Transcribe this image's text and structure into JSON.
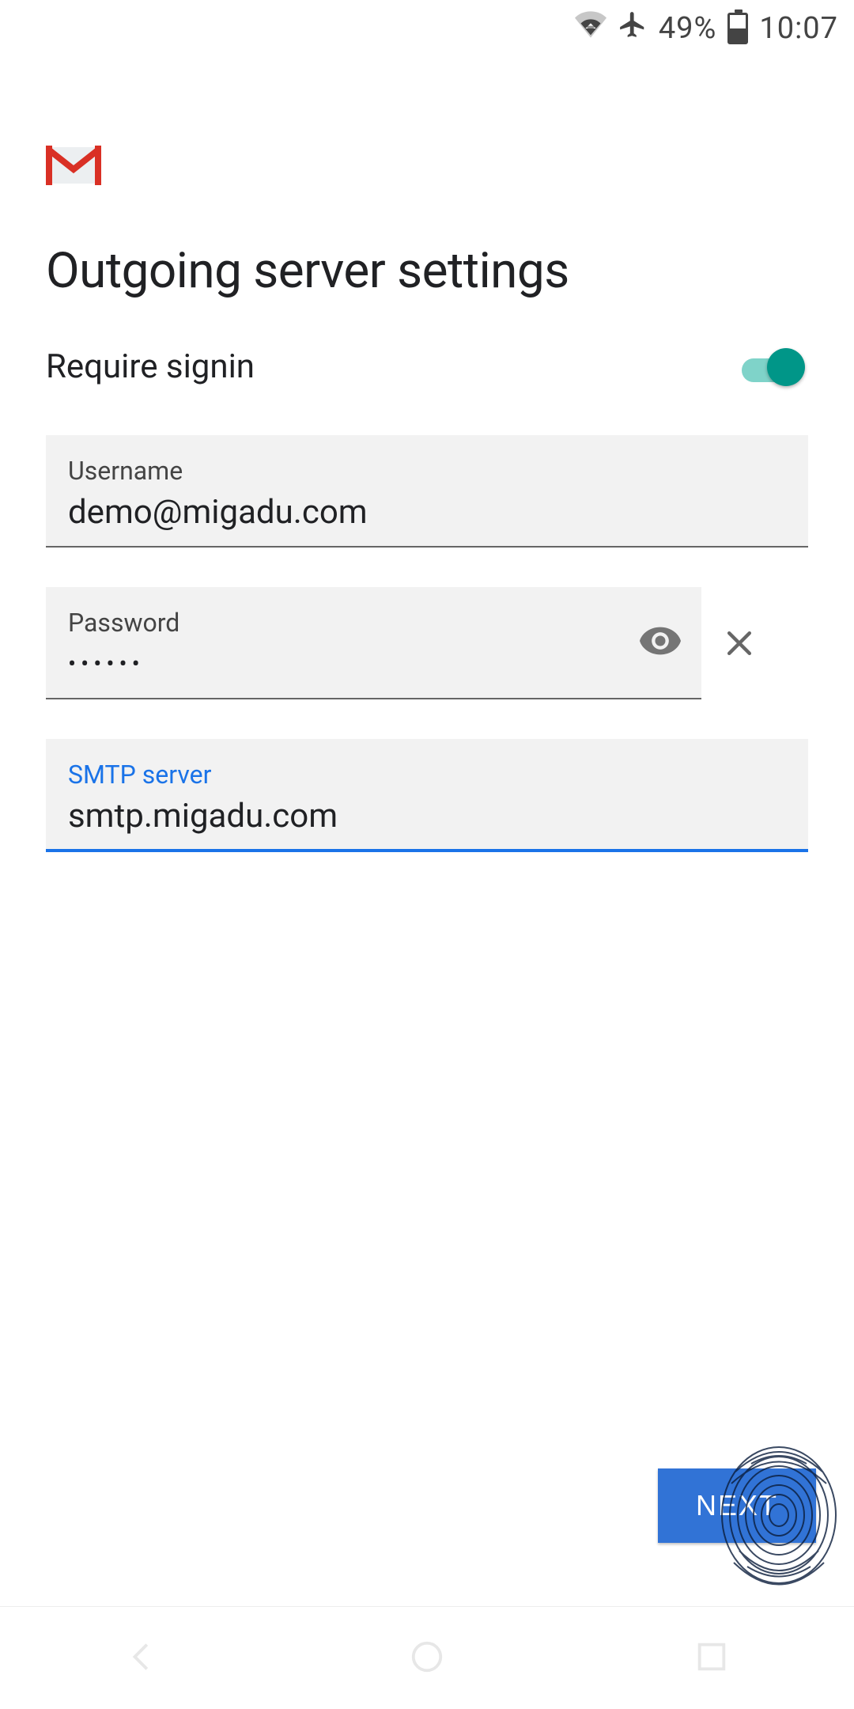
{
  "status": {
    "battery_pct": "49%",
    "clock": "10:07"
  },
  "page": {
    "title": "Outgoing server settings"
  },
  "toggle": {
    "label": "Require signin",
    "on": true
  },
  "fields": {
    "username": {
      "label": "Username",
      "value": "demo@migadu.com"
    },
    "password": {
      "label": "Password",
      "value": "••••••"
    },
    "smtp": {
      "label": "SMTP server",
      "value": "smtp.migadu.com"
    }
  },
  "buttons": {
    "next": "NEXT"
  },
  "colors": {
    "accent": "#1a73e8",
    "toggle": "#009688",
    "button": "#3173d6"
  }
}
